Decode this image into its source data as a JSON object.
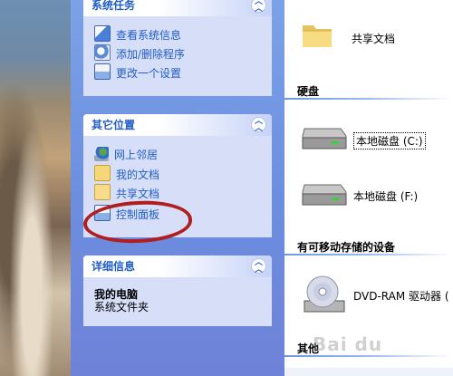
{
  "task_pane": {
    "system_tasks": {
      "title": "系统任务",
      "items": [
        {
          "label": "查看系统信息",
          "icon": "system-info-icon"
        },
        {
          "label": "添加/删除程序",
          "icon": "add-remove-programs-icon"
        },
        {
          "label": "更改一个设置",
          "icon": "control-panel-icon"
        }
      ]
    },
    "other_places": {
      "title": "其它位置",
      "items": [
        {
          "label": "网上邻居",
          "icon": "network-places-icon"
        },
        {
          "label": "我的文档",
          "icon": "my-documents-icon"
        },
        {
          "label": "共享文档",
          "icon": "shared-folder-icon"
        },
        {
          "label": "控制面板",
          "icon": "control-panel-icon"
        }
      ]
    },
    "details": {
      "title": "详细信息",
      "name": "我的电脑",
      "type": "系统文件夹"
    }
  },
  "content": {
    "shared_folder_label": "共享文档",
    "sections": {
      "hard_disks": "硬盘",
      "removable": "有可移动存储的设备",
      "other": "其他"
    },
    "drives": [
      {
        "label": "本地磁盘 (C:)"
      },
      {
        "label": "本地磁盘 (F:)"
      }
    ],
    "removable_drives": [
      {
        "label": "DVD-RAM 驱动器 ("
      }
    ]
  },
  "watermark": "Bai du",
  "colors": {
    "pane_blue": "#6d8fe0",
    "link_blue": "#215dc6",
    "highlight_red": "#b01f1f"
  }
}
